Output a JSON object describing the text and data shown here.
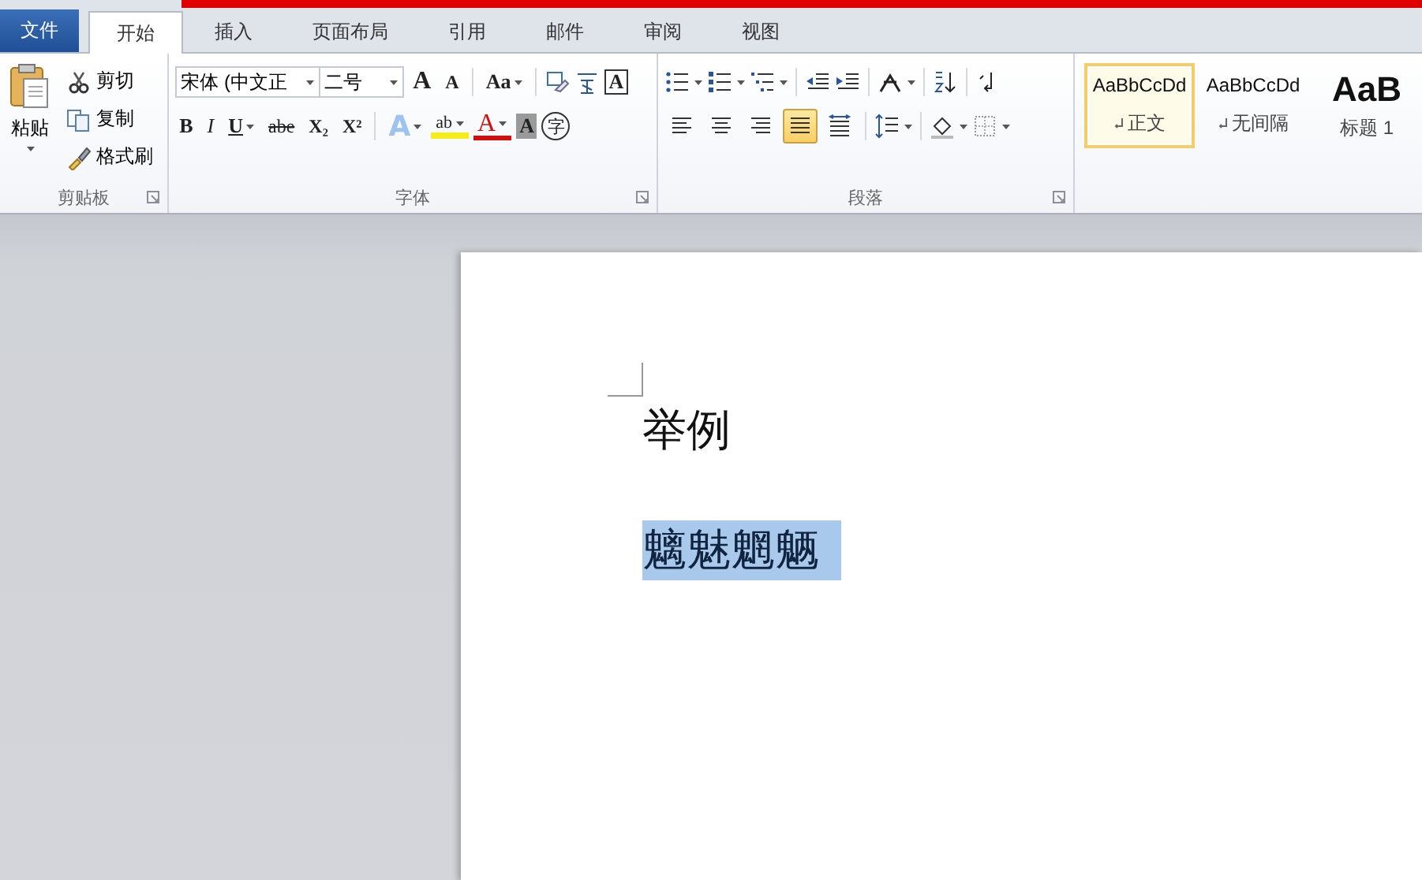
{
  "tabs": [
    {
      "label": "文件",
      "kind": "file",
      "selected": false
    },
    {
      "label": "开始",
      "kind": "tab",
      "selected": true
    },
    {
      "label": "插入",
      "kind": "tab",
      "selected": false
    },
    {
      "label": "页面布局",
      "kind": "tab",
      "selected": false
    },
    {
      "label": "引用",
      "kind": "tab",
      "selected": false
    },
    {
      "label": "邮件",
      "kind": "tab",
      "selected": false
    },
    {
      "label": "审阅",
      "kind": "tab",
      "selected": false
    },
    {
      "label": "视图",
      "kind": "tab",
      "selected": false
    }
  ],
  "clipboard": {
    "paste": "粘贴",
    "items": [
      {
        "label": "剪切",
        "kind": "cut"
      },
      {
        "label": "复制",
        "kind": "copy"
      },
      {
        "label": "格式刷",
        "kind": "painter"
      }
    ],
    "group_label": "剪贴板"
  },
  "font": {
    "font_name": "宋体 (中文正",
    "font_size": "二号",
    "group_label": "字体",
    "row1": [
      {
        "kind": "grow",
        "label": "A"
      },
      {
        "kind": "shrink",
        "label": "A"
      },
      {
        "kind": "sep"
      },
      {
        "kind": "case",
        "label": "Aa"
      },
      {
        "kind": "sep"
      },
      {
        "kind": "clear"
      },
      {
        "kind": "phonetic"
      },
      {
        "kind": "border",
        "label": "A"
      }
    ],
    "row2": [
      {
        "kind": "bold",
        "label": "B"
      },
      {
        "kind": "italic",
        "label": "I"
      },
      {
        "kind": "underline",
        "label": "U"
      },
      {
        "kind": "strike",
        "label": "abe"
      },
      {
        "kind": "sub",
        "label": "X₂"
      },
      {
        "kind": "sup",
        "label": "X²"
      },
      {
        "kind": "sep"
      },
      {
        "kind": "effect",
        "label": "A"
      },
      {
        "kind": "highlight",
        "label": "ab"
      },
      {
        "kind": "color",
        "label": "A"
      },
      {
        "kind": "shading",
        "label": "A"
      },
      {
        "kind": "enclose",
        "label": "字"
      }
    ]
  },
  "paragraph": {
    "group_label": "段落",
    "alignment": [
      {
        "kind": "left",
        "selected": false
      },
      {
        "kind": "center",
        "selected": false
      },
      {
        "kind": "right",
        "selected": false
      },
      {
        "kind": "justify",
        "selected": true
      },
      {
        "kind": "distributed",
        "selected": false
      }
    ]
  },
  "styles": [
    {
      "preview": "AaBbCcDd",
      "name": "正文",
      "paragraph_mark": true,
      "kind": "normal",
      "selected": true
    },
    {
      "preview": "AaBbCcDd",
      "name": "无间隔",
      "paragraph_mark": true,
      "kind": "normal",
      "selected": false
    },
    {
      "preview": "AaB",
      "name": "标题 1",
      "paragraph_mark": false,
      "kind": "heading",
      "selected": false
    }
  ],
  "document": {
    "lines": [
      {
        "text": "举例",
        "selected": false
      },
      {
        "text": "魑魅魍魉",
        "selected": true
      }
    ]
  }
}
